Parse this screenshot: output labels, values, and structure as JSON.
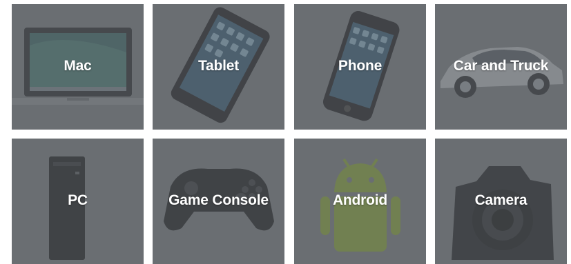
{
  "categories": [
    {
      "label": "Mac",
      "icon": "laptop-icon"
    },
    {
      "label": "Tablet",
      "icon": "tablet-icon"
    },
    {
      "label": "Phone",
      "icon": "phone-icon"
    },
    {
      "label": "Car and Truck",
      "icon": "car-icon"
    },
    {
      "label": "PC",
      "icon": "desktop-tower-icon"
    },
    {
      "label": "Game Console",
      "icon": "game-controller-icon"
    },
    {
      "label": "Android",
      "icon": "android-icon"
    },
    {
      "label": "Camera",
      "icon": "camera-icon"
    }
  ],
  "colors": {
    "tile_bg": "#7b7f84",
    "label": "#ffffff",
    "android_green": "#8aa63a"
  }
}
